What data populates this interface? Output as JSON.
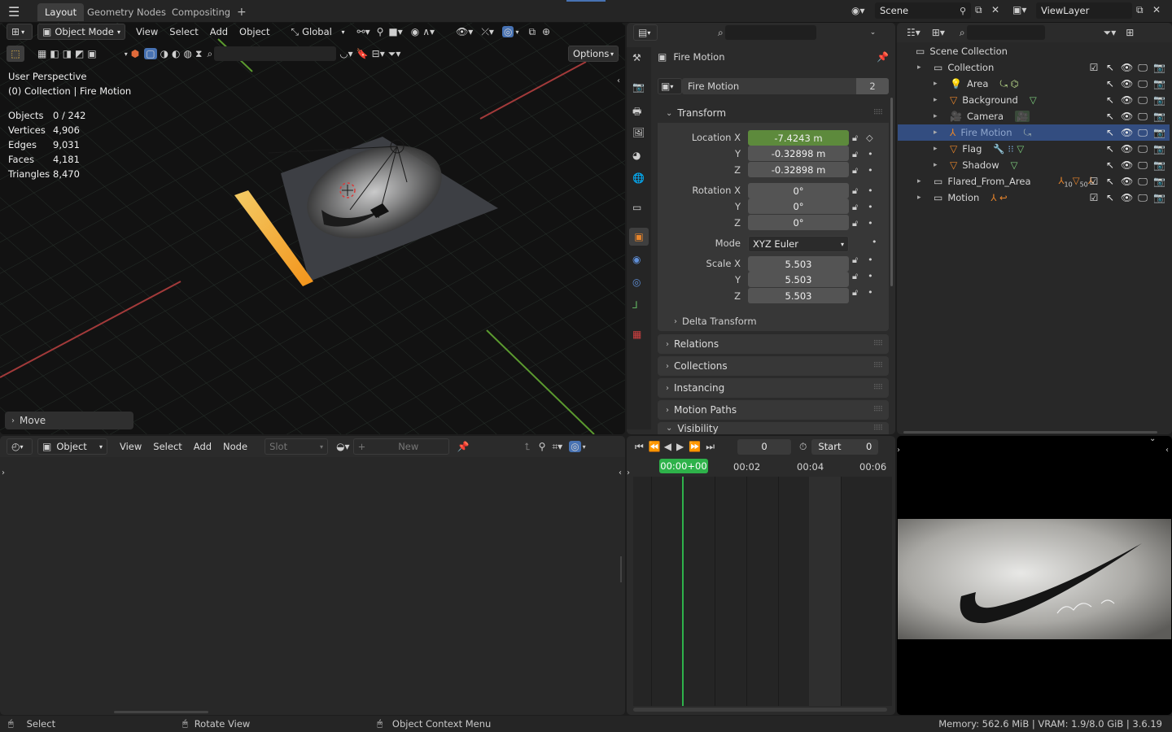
{
  "workspace_tabs": [
    "Layout",
    "Geometry Nodes",
    "Compositing"
  ],
  "workspace_add": "+",
  "scene": {
    "name": "Scene",
    "view_layer": "ViewLayer"
  },
  "viewport": {
    "mode": "Object Mode",
    "menus": [
      "View",
      "Select",
      "Add",
      "Object"
    ],
    "orientation": "Global",
    "options_label": "Options",
    "perspective": "User Perspective",
    "collection_info": "(0) Collection | Fire Motion",
    "stats": [
      {
        "label": "Objects",
        "value": "0 / 242"
      },
      {
        "label": "Vertices",
        "value": "4,906"
      },
      {
        "label": "Edges",
        "value": "9,031"
      },
      {
        "label": "Faces",
        "value": "4,181"
      },
      {
        "label": "Triangles",
        "value": "8,470"
      }
    ],
    "last_op": "Move"
  },
  "properties": {
    "object_name": "Fire Motion",
    "datablock_name": "Fire Motion",
    "datablock_users": "2",
    "transform_title": "Transform",
    "location": {
      "label": "Location X",
      "x": "-7.4243 m",
      "y": "-0.32898 m",
      "z": "-0.32898 m"
    },
    "rotation": {
      "label": "Rotation X",
      "x": "0°",
      "y": "0°",
      "z": "0°"
    },
    "mode_label": "Mode",
    "mode_value": "XYZ Euler",
    "scale": {
      "label": "Scale X",
      "x": "5.503",
      "y": "5.503",
      "z": "5.503"
    },
    "axis_y": "Y",
    "axis_z": "Z",
    "delta_transform": "Delta Transform",
    "panels": [
      "Relations",
      "Collections",
      "Instancing",
      "Motion Paths",
      "Visibility"
    ]
  },
  "outliner": {
    "root": "Scene Collection",
    "rows": [
      {
        "name": "Collection",
        "indent": 1,
        "kind": "collection"
      },
      {
        "name": "Area",
        "indent": 2,
        "kind": "light"
      },
      {
        "name": "Background",
        "indent": 2,
        "kind": "mesh"
      },
      {
        "name": "Camera",
        "indent": 2,
        "kind": "camera"
      },
      {
        "name": "Fire Motion",
        "indent": 2,
        "kind": "empty",
        "selected": true
      },
      {
        "name": "Flag",
        "indent": 2,
        "kind": "mesh"
      },
      {
        "name": "Shadow",
        "indent": 2,
        "kind": "mesh"
      },
      {
        "name": "Flared_From_Area",
        "indent": 1,
        "kind": "collection",
        "badges": [
          "10",
          "50"
        ]
      },
      {
        "name": "Motion",
        "indent": 1,
        "kind": "collection"
      }
    ]
  },
  "shader_editor": {
    "object_type": "Object",
    "menus": [
      "View",
      "Select",
      "Add",
      "Node"
    ],
    "slot": "Slot",
    "new_label": "New"
  },
  "timeline": {
    "current_frame": "0",
    "start_label": "Start",
    "start_value": "0",
    "playhead": "00:00+00",
    "ticks": [
      "00:02",
      "00:04",
      "00:06"
    ]
  },
  "status": {
    "select": "Select",
    "rotate": "Rotate View",
    "context": "Object Context Menu",
    "memory": "Memory: 562.6 MiB | VRAM: 1.9/8.0 GiB | 3.6.19"
  },
  "colors": {
    "accent": "#4772b3",
    "selection": "#334d80",
    "active_field": "#5d8a3c",
    "playhead": "#2eb24a"
  }
}
